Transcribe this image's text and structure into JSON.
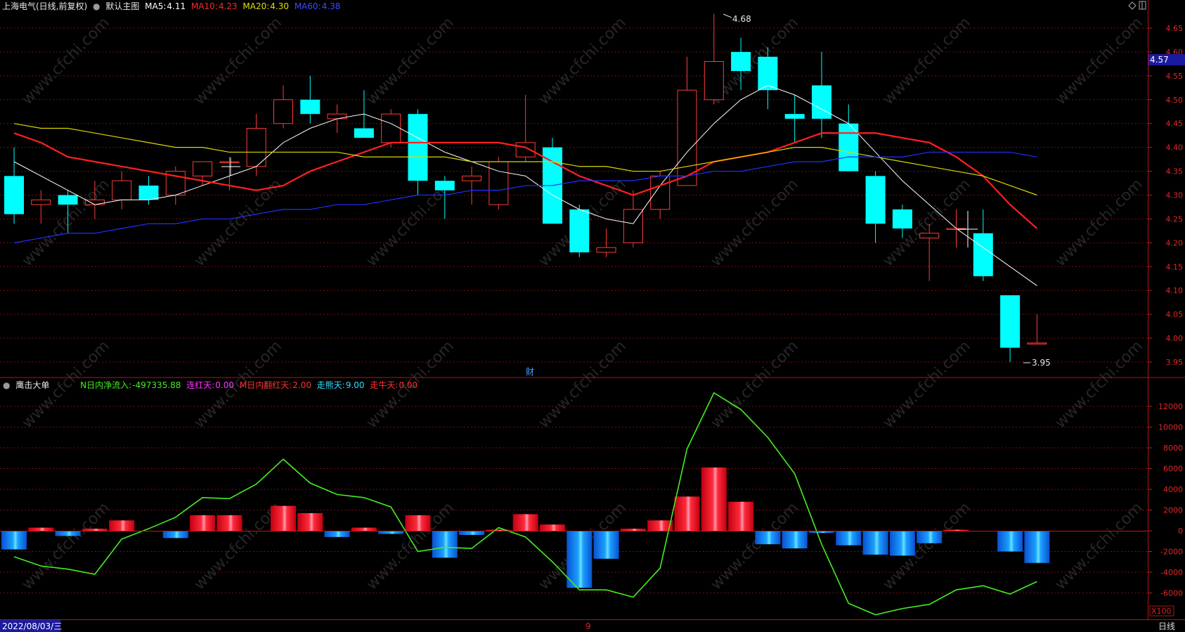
{
  "top_header": {
    "title": "上海电气(日线,前复权)",
    "main_chart_label": "默认主图",
    "ma5_label": "MA5:",
    "ma5_value": "4.11",
    "ma10_label": "MA10:",
    "ma10_value": "4.23",
    "ma20_label": "MA20:",
    "ma20_value": "4.30",
    "ma60_label": "MA60:",
    "ma60_value": "4.38"
  },
  "sub_header": {
    "name": "鹰击大单",
    "n_label": "N日内净流入:",
    "n_value": "-497335.88",
    "lianhong_label": "连红天:",
    "lianhong_value": "0.00",
    "m_label": "M日内翻红天:",
    "m_value": "2.00",
    "zouneng_label": "走熊天:",
    "zouneng_value": "9.00",
    "zouniu_label": "走牛天:",
    "zouniu_value": "0.00"
  },
  "bottom_bar": {
    "date": "2022/08/03/三",
    "month_marker": "9",
    "period": "日线"
  },
  "markers": {
    "high_label": "4.68",
    "low_label": "3.95",
    "cai_label": "财",
    "current_price": "4.57",
    "x100": "X100"
  },
  "watermark": "www.cfchi.com",
  "colors": {
    "up": "#ff3b3b",
    "down": "#00ffff",
    "ma5": "#ffffff",
    "ma10": "#ff2020",
    "ma20": "#d8d800",
    "ma60": "#2030ff",
    "grid": "#7a1010",
    "net_line": "#44ee22"
  },
  "chart_data": [
    {
      "type": "candlestick",
      "title": "上海电气(日线,前复权)",
      "ylim": [
        3.92,
        4.69
      ],
      "y_ticks": [
        "4.65",
        "4.60",
        "4.55",
        "4.50",
        "4.45",
        "4.40",
        "4.35",
        "4.30",
        "4.25",
        "4.20",
        "4.15",
        "4.10",
        "4.05",
        "4.00",
        "3.95"
      ],
      "candles": [
        {
          "o": 4.34,
          "h": 4.4,
          "l": 4.24,
          "c": 4.26
        },
        {
          "o": 4.28,
          "h": 4.31,
          "l": 4.24,
          "c": 4.29
        },
        {
          "o": 4.3,
          "h": 4.31,
          "l": 4.22,
          "c": 4.28
        },
        {
          "o": 4.28,
          "h": 4.33,
          "l": 4.25,
          "c": 4.29
        },
        {
          "o": 4.29,
          "h": 4.35,
          "l": 4.27,
          "c": 4.33
        },
        {
          "o": 4.32,
          "h": 4.34,
          "l": 4.28,
          "c": 4.29
        },
        {
          "o": 4.3,
          "h": 4.36,
          "l": 4.28,
          "c": 4.35
        },
        {
          "o": 4.34,
          "h": 4.37,
          "l": 4.32,
          "c": 4.37
        },
        {
          "o": 4.37,
          "h": 4.38,
          "l": 4.31,
          "c": 4.37
        },
        {
          "o": 4.36,
          "h": 4.47,
          "l": 4.34,
          "c": 4.44
        },
        {
          "o": 4.45,
          "h": 4.53,
          "l": 4.44,
          "c": 4.5
        },
        {
          "o": 4.5,
          "h": 4.55,
          "l": 4.45,
          "c": 4.47
        },
        {
          "o": 4.46,
          "h": 4.49,
          "l": 4.43,
          "c": 4.47
        },
        {
          "o": 4.44,
          "h": 4.52,
          "l": 4.42,
          "c": 4.42
        },
        {
          "o": 4.41,
          "h": 4.48,
          "l": 4.4,
          "c": 4.47
        },
        {
          "o": 4.47,
          "h": 4.48,
          "l": 4.3,
          "c": 4.33
        },
        {
          "o": 4.33,
          "h": 4.34,
          "l": 4.25,
          "c": 4.31
        },
        {
          "o": 4.33,
          "h": 4.36,
          "l": 4.28,
          "c": 4.34
        },
        {
          "o": 4.28,
          "h": 4.38,
          "l": 4.27,
          "c": 4.37
        },
        {
          "o": 4.38,
          "h": 4.51,
          "l": 4.37,
          "c": 4.41
        },
        {
          "o": 4.4,
          "h": 4.42,
          "l": 4.24,
          "c": 4.24
        },
        {
          "o": 4.27,
          "h": 4.28,
          "l": 4.17,
          "c": 4.18
        },
        {
          "o": 4.18,
          "h": 4.23,
          "l": 4.17,
          "c": 4.19
        },
        {
          "o": 4.2,
          "h": 4.31,
          "l": 4.19,
          "c": 4.27
        },
        {
          "o": 4.27,
          "h": 4.35,
          "l": 4.25,
          "c": 4.34
        },
        {
          "o": 4.32,
          "h": 4.59,
          "l": 4.32,
          "c": 4.52
        },
        {
          "o": 4.5,
          "h": 4.68,
          "l": 4.49,
          "c": 4.58
        },
        {
          "o": 4.6,
          "h": 4.63,
          "l": 4.52,
          "c": 4.56
        },
        {
          "o": 4.59,
          "h": 4.61,
          "l": 4.48,
          "c": 4.52
        },
        {
          "o": 4.47,
          "h": 4.51,
          "l": 4.41,
          "c": 4.46
        },
        {
          "o": 4.53,
          "h": 4.6,
          "l": 4.42,
          "c": 4.46
        },
        {
          "o": 4.45,
          "h": 4.49,
          "l": 4.35,
          "c": 4.35
        },
        {
          "o": 4.34,
          "h": 4.35,
          "l": 4.2,
          "c": 4.24
        },
        {
          "o": 4.27,
          "h": 4.28,
          "l": 4.21,
          "c": 4.23
        },
        {
          "o": 4.21,
          "h": 4.24,
          "l": 4.12,
          "c": 4.22
        },
        {
          "o": 4.23,
          "h": 4.27,
          "l": 4.19,
          "c": 4.23
        },
        {
          "o": 4.22,
          "h": 4.27,
          "l": 4.12,
          "c": 4.13
        },
        {
          "o": 4.09,
          "h": 4.09,
          "l": 3.95,
          "c": 3.98
        },
        {
          "o": 3.99,
          "h": 4.05,
          "l": 3.99,
          "c": 3.99
        }
      ],
      "series": [
        {
          "name": "MA5",
          "values": [
            4.37,
            4.34,
            4.31,
            4.28,
            4.29,
            4.29,
            4.3,
            4.32,
            4.34,
            4.36,
            4.41,
            4.44,
            4.46,
            4.47,
            4.45,
            4.42,
            4.39,
            4.37,
            4.35,
            4.34,
            4.3,
            4.27,
            4.25,
            4.24,
            4.32,
            4.39,
            4.45,
            4.5,
            4.53,
            4.51,
            4.48,
            4.45,
            4.39,
            4.33,
            4.28,
            4.23,
            4.19,
            4.15,
            4.11
          ]
        },
        {
          "name": "MA10",
          "values": [
            4.43,
            4.41,
            4.38,
            4.37,
            4.36,
            4.35,
            4.34,
            4.33,
            4.32,
            4.31,
            4.32,
            4.35,
            4.37,
            4.39,
            4.41,
            4.41,
            4.41,
            4.41,
            4.41,
            4.4,
            4.37,
            4.34,
            4.32,
            4.3,
            4.32,
            4.34,
            4.37,
            4.38,
            4.39,
            4.41,
            4.43,
            4.43,
            4.43,
            4.42,
            4.41,
            4.38,
            4.34,
            4.28,
            4.23
          ]
        },
        {
          "name": "MA20",
          "values": [
            4.45,
            4.44,
            4.44,
            4.43,
            4.42,
            4.41,
            4.4,
            4.4,
            4.39,
            4.39,
            4.39,
            4.39,
            4.39,
            4.38,
            4.38,
            4.38,
            4.38,
            4.37,
            4.37,
            4.37,
            4.37,
            4.36,
            4.36,
            4.35,
            4.35,
            4.36,
            4.37,
            4.38,
            4.39,
            4.4,
            4.4,
            4.39,
            4.38,
            4.37,
            4.36,
            4.35,
            4.34,
            4.32,
            4.3
          ]
        },
        {
          "name": "MA60",
          "values": [
            4.2,
            4.21,
            4.22,
            4.22,
            4.23,
            4.24,
            4.24,
            4.25,
            4.25,
            4.26,
            4.27,
            4.27,
            4.28,
            4.28,
            4.29,
            4.3,
            4.3,
            4.31,
            4.31,
            4.32,
            4.32,
            4.33,
            4.33,
            4.33,
            4.34,
            4.34,
            4.35,
            4.35,
            4.36,
            4.37,
            4.37,
            4.38,
            4.38,
            4.38,
            4.39,
            4.39,
            4.39,
            4.39,
            4.38
          ]
        }
      ]
    },
    {
      "type": "bar",
      "title": "鹰击大单",
      "ylim": [
        -8200,
        13500
      ],
      "y_ticks": [
        "12000",
        "10000",
        "8000",
        "6000",
        "4000",
        "2000",
        "0",
        "-2000",
        "-4000",
        "-6000"
      ],
      "bars": [
        -1800,
        300,
        -500,
        200,
        1000,
        0,
        -700,
        1500,
        1500,
        0,
        2400,
        1700,
        -600,
        300,
        -300,
        1500,
        -2600,
        -400,
        100,
        1600,
        600,
        -5500,
        -2700,
        200,
        1000,
        3300,
        6100,
        2800,
        -1300,
        -1700,
        -200,
        -1400,
        -2300,
        -2400,
        -1200,
        100,
        0,
        -2000,
        -3100
      ],
      "line_name": "N日内净流入",
      "line": [
        -2500,
        -3400,
        -3700,
        -4200,
        -800,
        200,
        1300,
        3200,
        3100,
        4500,
        6900,
        4600,
        3500,
        3200,
        2300,
        -2000,
        -1600,
        -1700,
        300,
        -600,
        -3000,
        -5700,
        -5700,
        -6400,
        -3600,
        7900,
        13300,
        11700,
        9000,
        5500,
        -1300,
        -7000,
        -8100,
        -7500,
        -7100,
        -5700,
        -5300,
        -6100,
        -4900
      ]
    }
  ]
}
